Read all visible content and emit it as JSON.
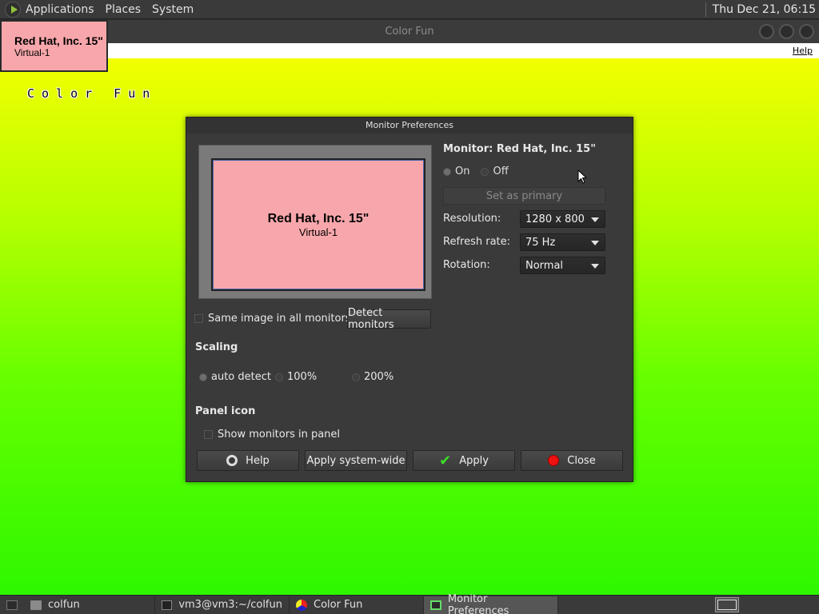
{
  "top_panel": {
    "menus": [
      "Applications",
      "Places",
      "System"
    ],
    "clock": "Thu Dec 21, 06:15"
  },
  "bg_window": {
    "title": "Color Fun",
    "help_menu": "Help",
    "canvas_text": "Color Fun"
  },
  "identify_popup": {
    "name": "Red Hat, Inc. 15\"",
    "output": "Virtual-1"
  },
  "dialog": {
    "title": "Monitor Preferences",
    "preview": {
      "name": "Red Hat, Inc. 15\"",
      "output": "Virtual-1"
    },
    "monitor_label": "Monitor: Red Hat, Inc. 15\"",
    "on_label": "On",
    "off_label": "Off",
    "set_primary_label": "Set as primary",
    "resolution_label": "Resolution:",
    "resolution_value": "1280 x 800",
    "refresh_label": "Refresh rate:",
    "refresh_value": "75 Hz",
    "rotation_label": "Rotation:",
    "rotation_value": "Normal",
    "same_image_label": "Same image in all monitors",
    "detect_label": "Detect monitors",
    "scaling_heading": "Scaling",
    "scaling_options": [
      "auto detect",
      "100%",
      "200%"
    ],
    "panel_icon_heading": "Panel icon",
    "show_monitors_label": "Show monitors in panel",
    "buttons": {
      "help": "Help",
      "apply_system_wide": "Apply system-wide",
      "apply": "Apply",
      "close": "Close"
    }
  },
  "taskbar": {
    "tasks": [
      "colfun",
      "vm3@vm3:~/colfun",
      "Color Fun",
      "Monitor Preferences"
    ]
  },
  "colors": {
    "monitor_pink": "#f7a7ab",
    "panel_bg": "#3a3a3a",
    "apply_check": "#3bdc2a",
    "close_red": "#e11111"
  }
}
